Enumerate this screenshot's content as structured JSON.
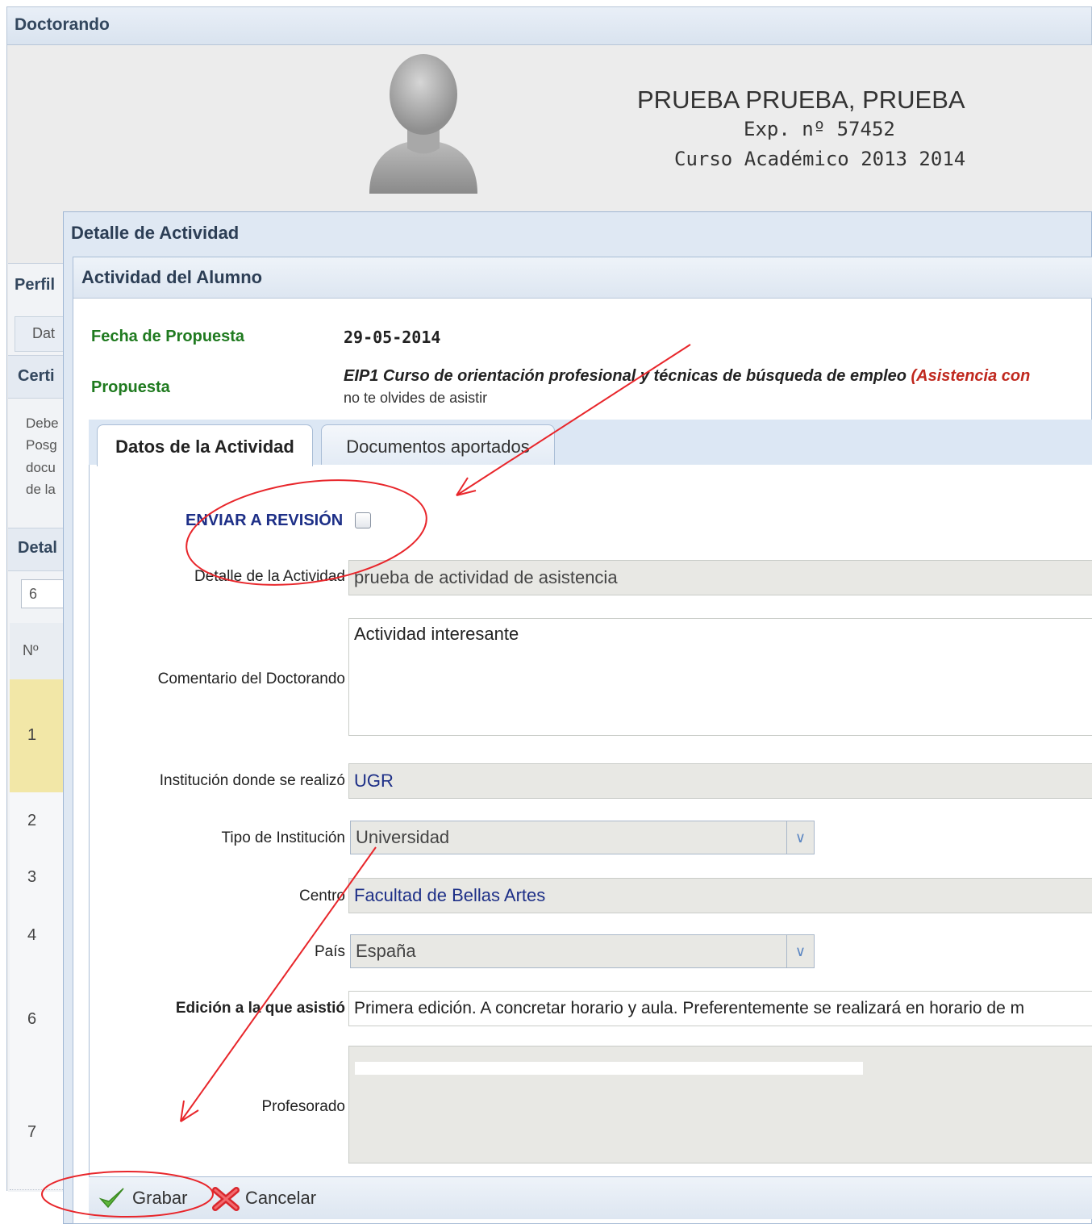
{
  "outer": {
    "title": "Doctorando"
  },
  "student": {
    "name": "PRUEBA PRUEBA, PRUEBA",
    "exp": "Exp. nº 57452",
    "course": "Curso Académico 2013 2014"
  },
  "left_panel": {
    "perfil": "Perfil",
    "tab_dat": "Dat",
    "certi": "Certi",
    "para_lines": [
      "Debe",
      "Posg",
      "docu",
      "de la"
    ],
    "detal": "Detal",
    "page_size": "6",
    "col_header": "Nº",
    "rows": [
      "1",
      "2",
      "3",
      "4",
      "6",
      "7"
    ]
  },
  "modal": {
    "title": "Detalle de Actividad",
    "inner_title": "Actividad del Alumno",
    "fecha_label": "Fecha de Propuesta",
    "fecha_value": "29-05-2014",
    "propuesta_label": "Propuesta",
    "propuesta_text": "EIP1 Curso de orientación profesional y técnicas de búsqueda de empleo ",
    "propuesta_red": "(Asistencia con",
    "propuesta_note": "no te olvides de asistir",
    "tabs": [
      "Datos de la Actividad",
      "Documentos aportados"
    ],
    "enviar_label": "ENVIAR A REVISIÓN",
    "fields": {
      "detalle_label": "Detalle de la Actividad",
      "detalle_value": "prueba de actividad de  asistencia",
      "comentario_label": "Comentario del Doctorando",
      "comentario_value": "Actividad interesante",
      "institucion_label": "Institución donde se realizó",
      "institucion_value": "UGR",
      "tipo_label": "Tipo de Institución",
      "tipo_value": "Universidad",
      "centro_label": "Centro",
      "centro_value": "Facultad de Bellas Artes",
      "pais_label": "País",
      "pais_value": "España",
      "edicion_label": "Edición a la que asistió",
      "edicion_value": "Primera edición. A concretar horario y aula. Preferentemente se realizará en horario de m",
      "profesorado_label": "Profesorado"
    },
    "buttons": {
      "grabar": "Grabar",
      "cancelar": "Cancelar"
    }
  },
  "colors": {
    "annotation": "#e8262b",
    "label_green": "#1f7a1f",
    "link_blue": "#1d2f87"
  },
  "icons": [
    "user-avatar-icon",
    "chevron-down-icon",
    "check-icon",
    "cross-icon"
  ]
}
